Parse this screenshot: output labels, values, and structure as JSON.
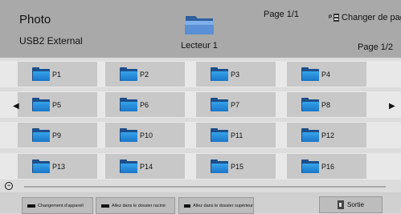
{
  "header": {
    "title": "Photo",
    "source": "USB2 External",
    "page_top": "Page 1/1",
    "change_page_label": "Changer de page",
    "change_page_badge": "P",
    "drive_label": "Lecteur 1",
    "page_right": "Page 1/2"
  },
  "grid": {
    "items": [
      {
        "label": "P1"
      },
      {
        "label": "P2"
      },
      {
        "label": "P3"
      },
      {
        "label": "P4"
      },
      {
        "label": "P5"
      },
      {
        "label": "P6"
      },
      {
        "label": "P7"
      },
      {
        "label": "P8"
      },
      {
        "label": "P9"
      },
      {
        "label": "P10"
      },
      {
        "label": "P11"
      },
      {
        "label": "P12"
      },
      {
        "label": "P13"
      },
      {
        "label": "P14"
      },
      {
        "label": "P15"
      },
      {
        "label": "P16"
      }
    ]
  },
  "nav": {
    "prev_symbol": "◀",
    "next_symbol": "▶"
  },
  "footer": {
    "btn1": "Changement d'appareil",
    "btn2": "Allez dans le dossier racine",
    "btn3": "Allez dans le dossier supérieur",
    "exit": "Sortie"
  },
  "colors": {
    "header_bg": "#a9a9a9",
    "tile_bg": "#c8c8c8",
    "folder_blue": "#1a76c8"
  }
}
